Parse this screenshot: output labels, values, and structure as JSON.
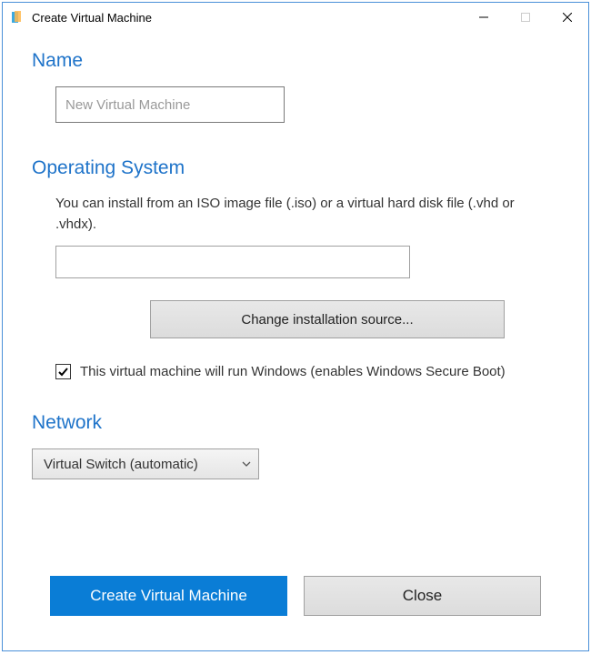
{
  "window": {
    "title": "Create Virtual Machine"
  },
  "name_section": {
    "heading": "Name",
    "placeholder": "New Virtual Machine",
    "value": ""
  },
  "os_section": {
    "heading": "Operating System",
    "description": "You can install from an ISO image file (.iso) or a virtual hard disk file (.vhd or .vhdx).",
    "path_value": "",
    "change_source_label": "Change installation source...",
    "windows_checkbox_checked": true,
    "windows_checkbox_label": "This virtual machine will run Windows (enables Windows Secure Boot)"
  },
  "network_section": {
    "heading": "Network",
    "selected": "Virtual Switch (automatic)"
  },
  "footer": {
    "create_label": "Create Virtual Machine",
    "close_label": "Close"
  }
}
